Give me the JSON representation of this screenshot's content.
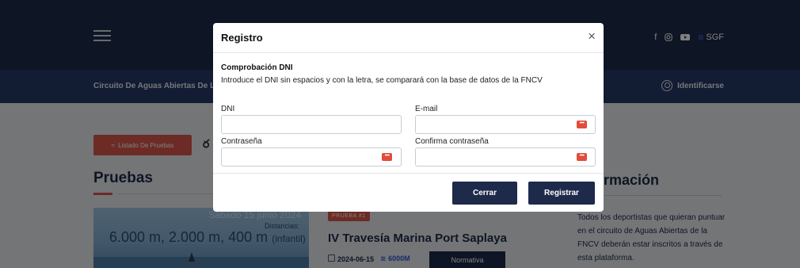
{
  "header": {
    "sgf_label": "SGF",
    "social_icons": [
      "facebook-icon",
      "instagram-icon",
      "youtube-icon"
    ]
  },
  "nav": {
    "breadcrumb": "Circuito De Aguas Abiertas De La Co",
    "login_label": "Identificarse"
  },
  "main": {
    "list_button_label": "Listado De Pruebas",
    "section_title": "Pruebas",
    "hero": {
      "date_text": "Sábado 15 junio 2024",
      "distances_label": "Distancias:",
      "distances_value": "6.000 m, 2.000 m, 400 m",
      "distances_note": "(infantil)"
    },
    "event": {
      "badge": "PRUEBA #1",
      "title": "IV Travesía Marina Port Saplaya",
      "date": "2024-06-15",
      "distance": "6000M",
      "normativa_label": "Normativa"
    },
    "info_title": "rmación",
    "info_text": "Todos los deportistas que quieran puntuar en el circuito de Aguas Abiertas de la FNCV deberán estar inscritos a través de esta plataforma."
  },
  "modal": {
    "title": "Registro",
    "close_symbol": "×",
    "subtitle": "Comprobación DNI",
    "description": "Introduce el DNI sin espacios y con la letra, se comparará con la base de datos de la FNCV",
    "fields": {
      "dni_label": "DNI",
      "dni_value": "",
      "email_label": "E-mail",
      "email_value": "",
      "password_label": "Contraseña",
      "password_value": "",
      "confirm_label": "Confirma contraseña",
      "confirm_value": ""
    },
    "close_button": "Cerrar",
    "register_button": "Registrar"
  },
  "colors": {
    "navy": "#1d2a49",
    "nav_blue": "#243866",
    "accent_red": "#d9584a",
    "link_blue": "#2f5bd6"
  }
}
